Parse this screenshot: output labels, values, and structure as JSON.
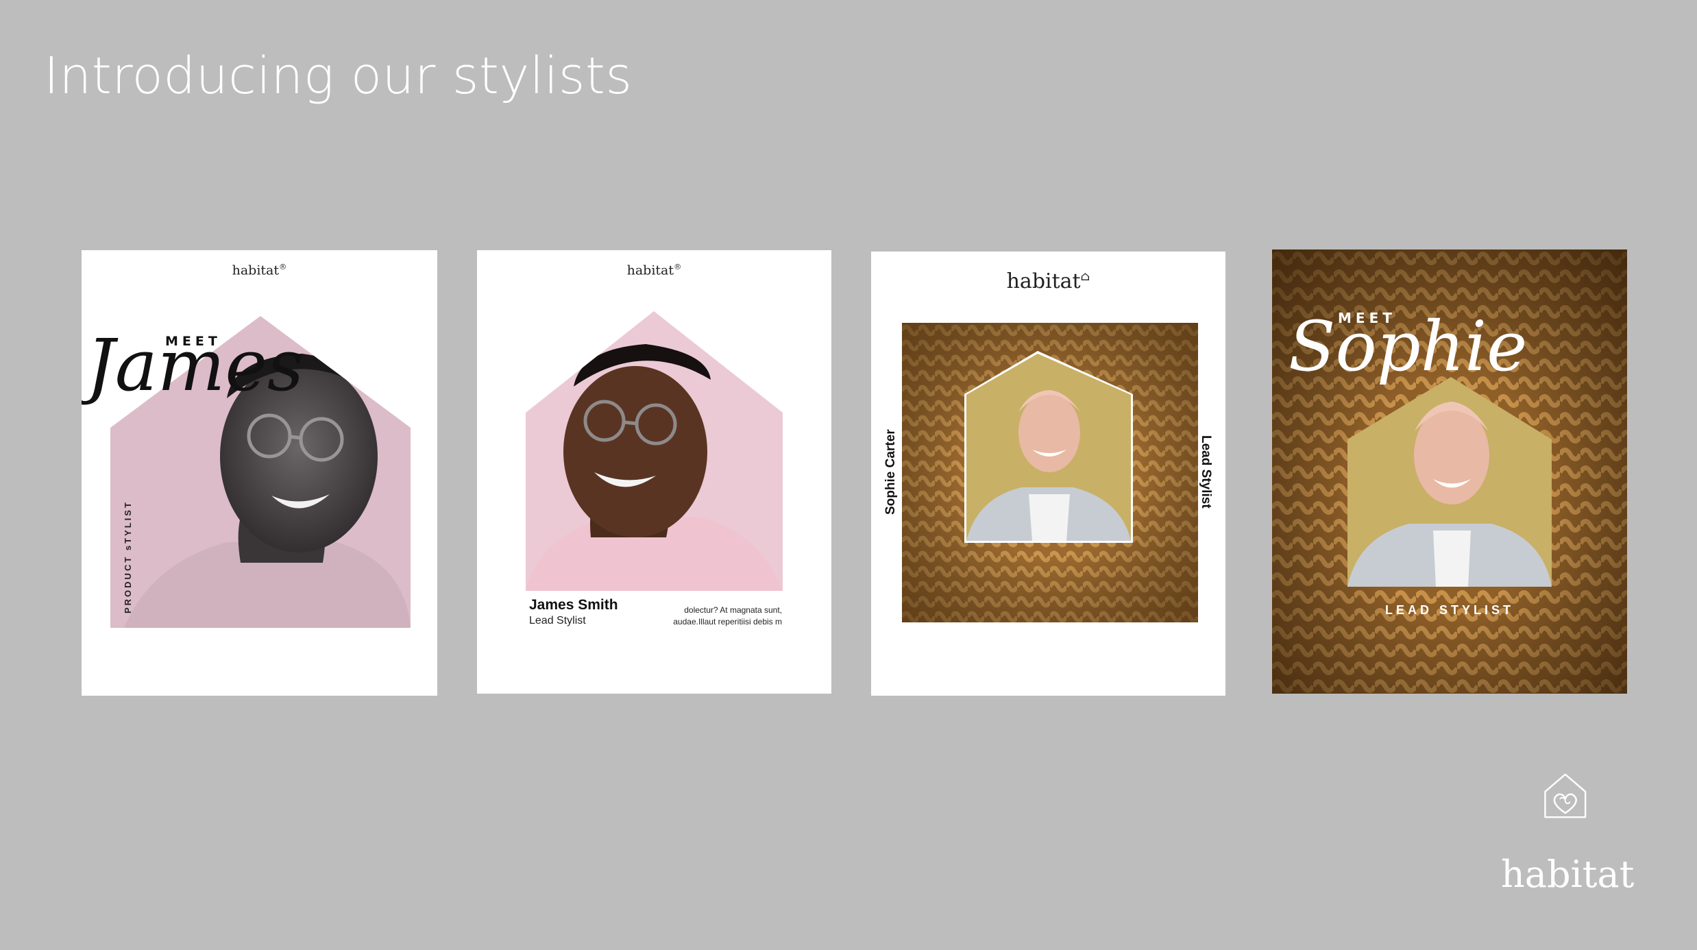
{
  "slide": {
    "title": "Introducing our stylists"
  },
  "cards": [
    {
      "brand": "habitat",
      "brand_mark": "®",
      "meet": "MEET",
      "name": "James",
      "vertical_label": "PRODUCT sTYLIST",
      "bg_color": "#e3c4d0"
    },
    {
      "brand": "habitat",
      "brand_mark": "®",
      "name": "James Smith",
      "role": "Lead Stylist",
      "body_line1": "dolectur? At magnata sunt,",
      "body_line2": "audae.Illaut reperitiisi debis m",
      "bg_color": "#ebcad5"
    },
    {
      "brand": "habitat",
      "brand_mark": "⌂",
      "left_vertical": "Sophie Carter",
      "right_vertical": "Lead Stylist",
      "house_color": "#c8b066"
    },
    {
      "meet": "MEET",
      "name": "Sophie",
      "role": "LEAD STYLIST",
      "house_color": "#c8b066"
    }
  ],
  "logo": {
    "text": "habitat",
    "icon": "house-heart-icon"
  },
  "colors": {
    "background": "#bdbdbd",
    "knit": "#a8773a",
    "white": "#ffffff"
  }
}
